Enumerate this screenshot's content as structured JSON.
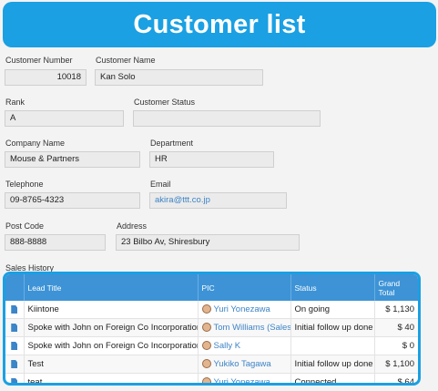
{
  "banner": {
    "title": "Customer list"
  },
  "fields": {
    "customer_number": {
      "label": "Customer Number",
      "value": "10018"
    },
    "customer_name": {
      "label": "Customer Name",
      "value": "Kan Solo"
    },
    "rank": {
      "label": "Rank",
      "value": "A"
    },
    "customer_status": {
      "label": "Customer Status",
      "value": ""
    },
    "company_name": {
      "label": "Company Name",
      "value": "Mouse & Partners"
    },
    "department": {
      "label": "Department",
      "value": "HR"
    },
    "telephone": {
      "label": "Telephone",
      "value": "09-8765-4323"
    },
    "email": {
      "label": "Email",
      "value": "akira@ttt.co.jp"
    },
    "post_code": {
      "label": "Post Code",
      "value": "888-8888"
    },
    "address": {
      "label": "Address",
      "value": "23 Bilbo Av, Shiresbury"
    }
  },
  "sales_history": {
    "label": "Sales History",
    "columns": [
      "Lead Title",
      "PIC",
      "Status",
      "Grand Total"
    ],
    "rows": [
      {
        "lead": "Kiintone",
        "pic": "Yuri Yonezawa",
        "status": "On going",
        "total": "$ 1,130"
      },
      {
        "lead": "Spoke with John on Foreign Co Incorporation",
        "pic": "Tom Williams (Sales)",
        "status": "Initial follow up done",
        "total": "$ 40"
      },
      {
        "lead": "Spoke with John on Foreign Co Incorporation",
        "pic": "Sally K",
        "status": "",
        "total": "$ 0"
      },
      {
        "lead": "Test",
        "pic": "Yukiko Tagawa",
        "status": "Initial follow up done",
        "total": "$ 1,100"
      },
      {
        "lead": "teat",
        "pic": "Yuri Yonezawa",
        "status": "Connected",
        "total": "$ 64"
      }
    ]
  },
  "icons": {
    "row_icon": "document-icon",
    "pic_icon": "user-avatar-icon"
  },
  "colors": {
    "accent": "#1aa0e3",
    "table_header": "#3d93d6",
    "link": "#3d84c6"
  }
}
